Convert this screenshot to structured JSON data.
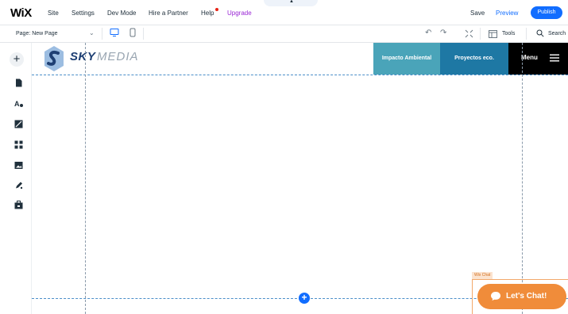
{
  "app": {
    "logo": "WiX"
  },
  "top_menu": {
    "items": [
      "Site",
      "Settings",
      "Dev Mode",
      "Hire a Partner",
      "Help"
    ],
    "upgrade": "Upgrade",
    "save": "Save",
    "preview": "Preview",
    "publish": "Publish"
  },
  "sub_bar": {
    "page": "Page: New Page",
    "tools": "Tools",
    "search": "Search"
  },
  "site": {
    "logo_sky": "SKY",
    "logo_media": "MEDIA",
    "nav": [
      "Impacto Ambiental",
      "Proyectos eco.",
      "Menu"
    ]
  },
  "chat": {
    "tag": "Wix Chat",
    "button": "Let's Chat!"
  },
  "colors": {
    "accent": "#116dff",
    "upgrade": "#9a27d5",
    "nav_teal": "#4aa4b9",
    "nav_blue": "#1e78a4",
    "nav_black": "#000000",
    "chat": "#f08c3a"
  },
  "icons": {
    "rail": [
      "add-icon",
      "pages-icon",
      "design-icon",
      "blocks-icon",
      "apps-icon",
      "media-icon",
      "pen-icon",
      "business-icon"
    ]
  }
}
